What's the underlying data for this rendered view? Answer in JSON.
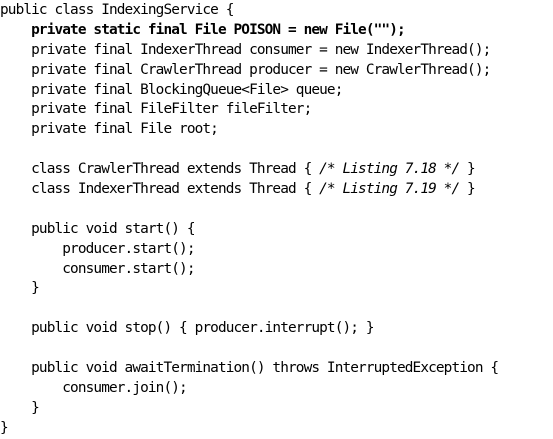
{
  "code": {
    "lines": [
      "public class IndexingService {",
      "    private static final File POISON = new File(\"\");",
      "    private final IndexerThread consumer = new IndexerThread();",
      "    private final CrawlerThread producer = new CrawlerThread();",
      "    private final BlockingQueue<File> queue;",
      "    private final FileFilter fileFilter;",
      "    private final File root;",
      "",
      "    class CrawlerThread extends Thread { ",
      "    class IndexerThread extends Thread { ",
      "",
      "    public void start() {",
      "        producer.start();",
      "        consumer.start();",
      "    }",
      "",
      "    public void stop() { producer.interrupt(); }",
      "",
      "    public void awaitTermination() throws InterruptedException {",
      "        consumer.join();",
      "    }",
      "}"
    ],
    "comments": {
      "crawler": "/* Listing 7.18 */",
      "indexer": "/* Listing 7.19 */"
    },
    "closing_brace": " }"
  }
}
